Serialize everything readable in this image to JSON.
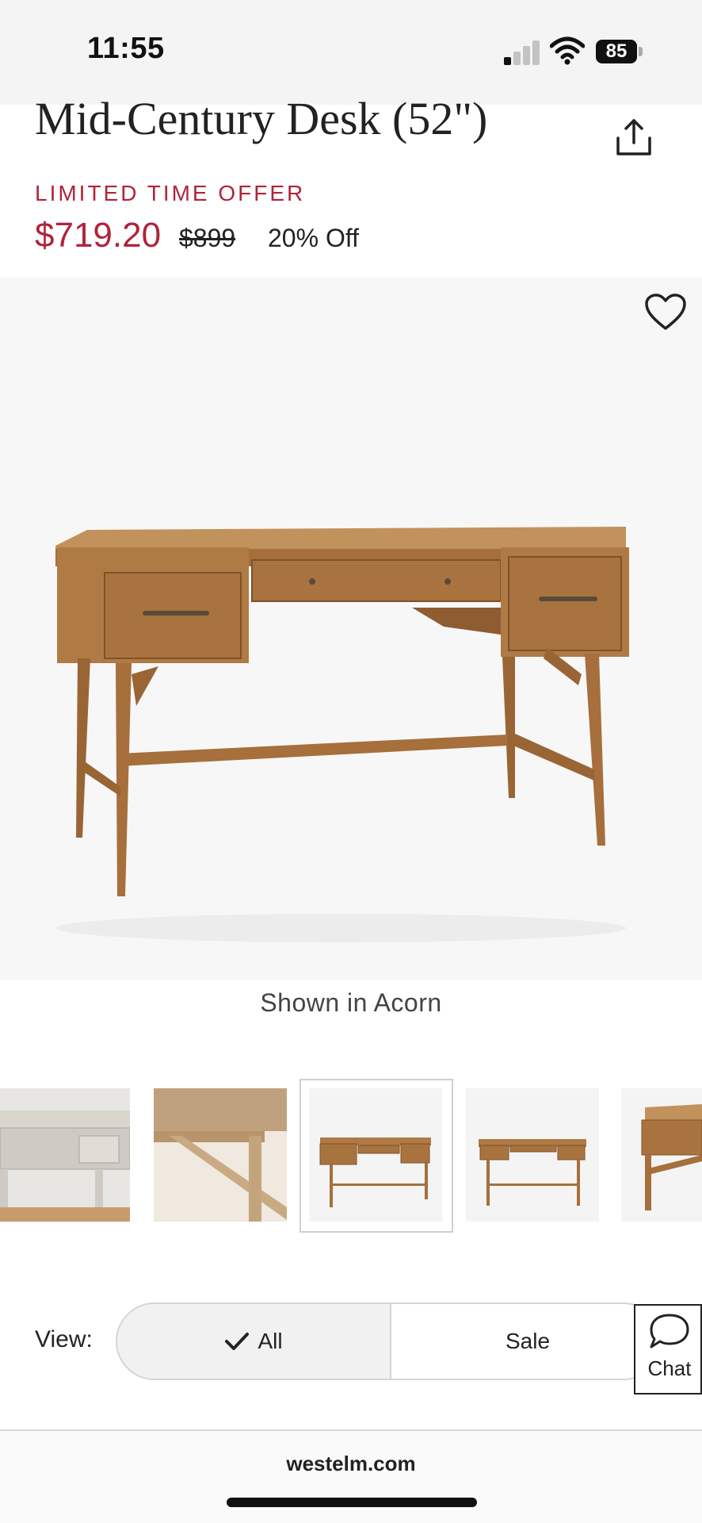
{
  "status_bar": {
    "time": "11:55",
    "battery": "85"
  },
  "product": {
    "title": "Mid-Century Desk (52\")",
    "offer_label": "LIMITED TIME OFFER",
    "sale_price": "$719.20",
    "original_price": "$899",
    "discount": "20% Off",
    "caption": "Shown in Acorn"
  },
  "thumbnails": {
    "count": 5,
    "selected_index": 2
  },
  "view_toggle": {
    "label": "View:",
    "options": [
      "All",
      "Sale"
    ],
    "selected": "All"
  },
  "chat": {
    "label": "Chat"
  },
  "browser": {
    "url": "westelm.com"
  },
  "colors": {
    "accent_red": "#b0243b",
    "wood": "#b07a45",
    "text_dark": "#222222"
  },
  "icons": [
    "signal-icon",
    "wifi-icon",
    "battery-icon",
    "share-icon",
    "heart-icon",
    "checkmark-icon",
    "chat-bubble-icon"
  ]
}
